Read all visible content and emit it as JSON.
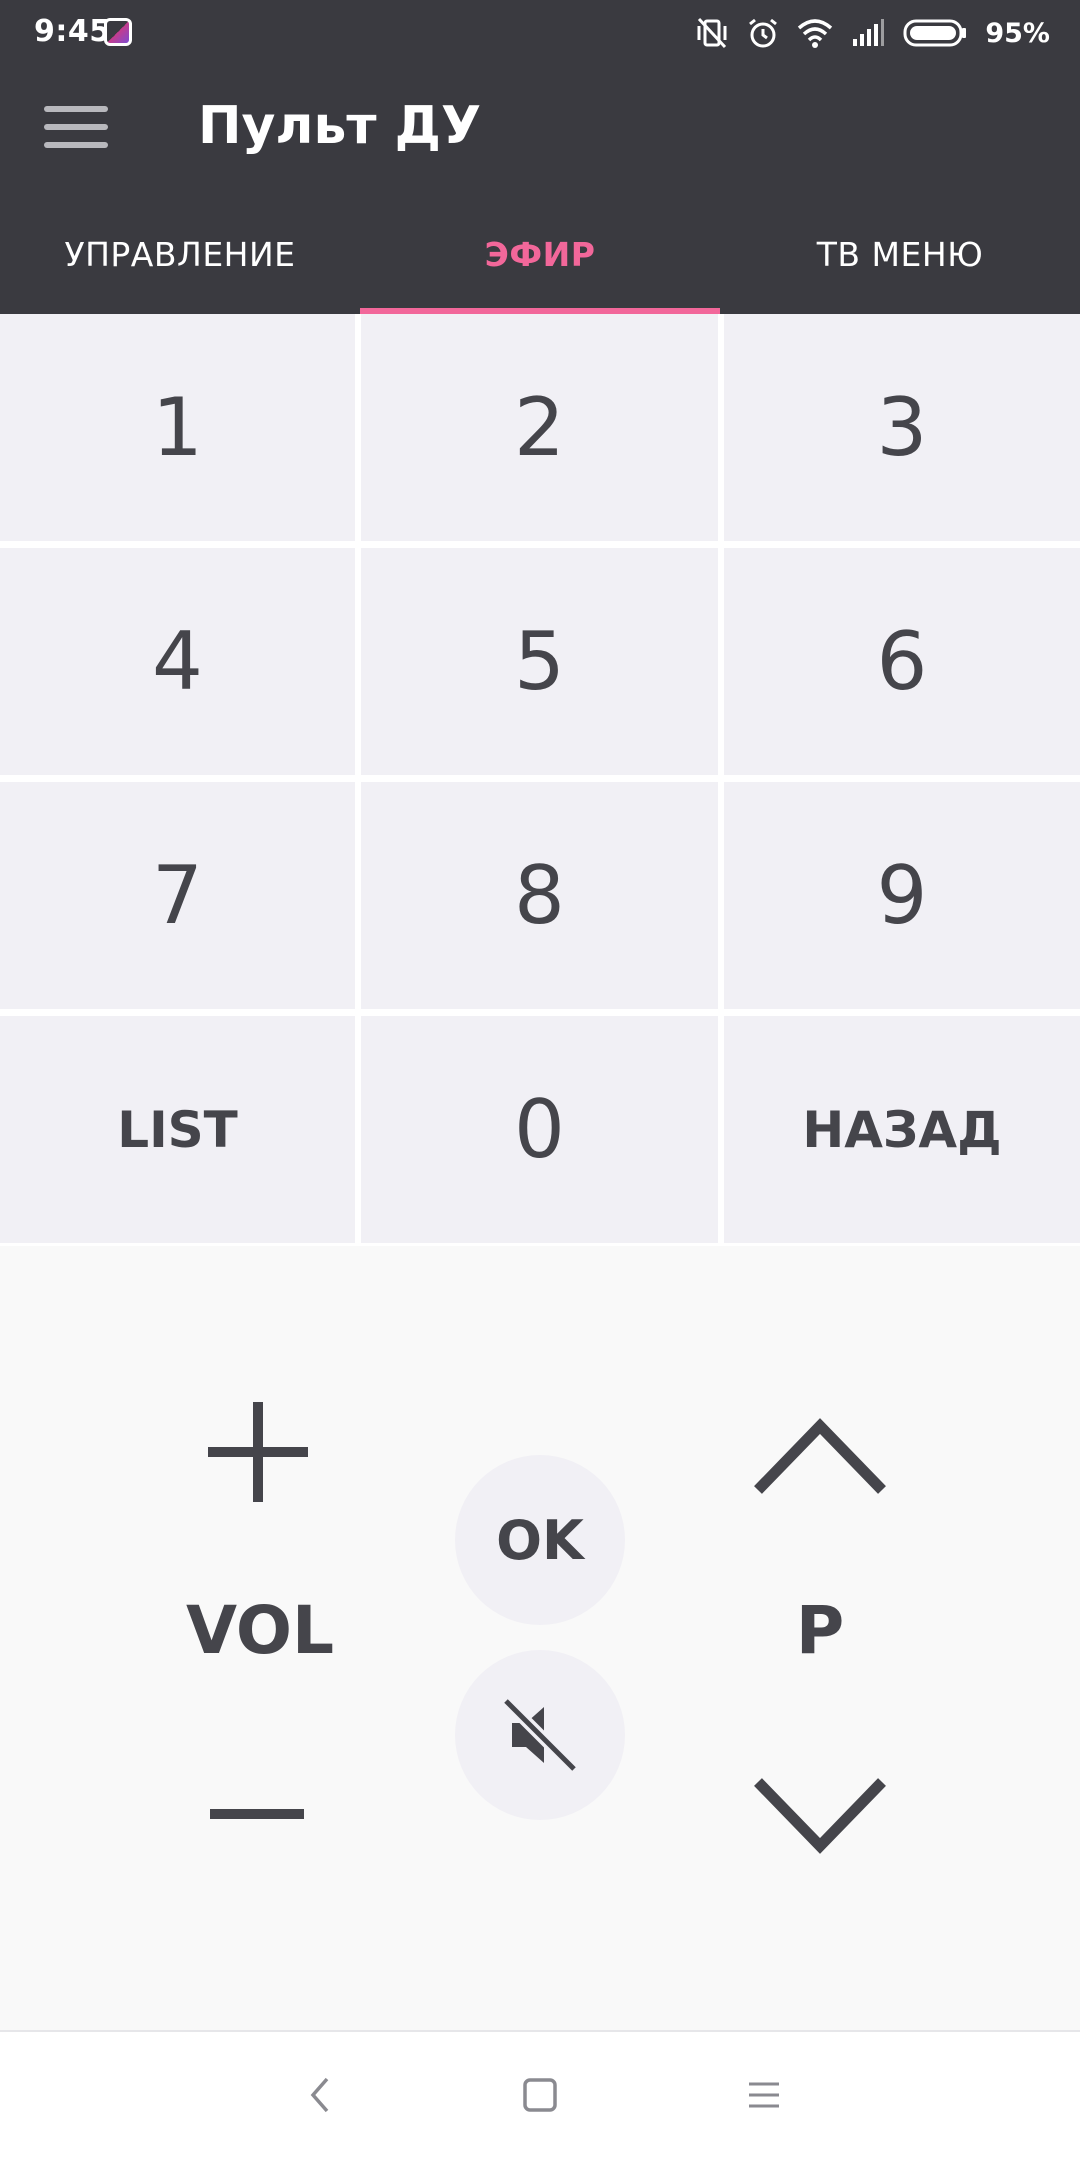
{
  "status_bar": {
    "time": "9:45",
    "battery_percent": "95%",
    "icons": [
      "app-notification-icon",
      "vibrate-off-icon",
      "alarm-icon",
      "wifi-icon",
      "signal-icon",
      "battery-icon"
    ]
  },
  "app_bar": {
    "title": "Пульт ДУ",
    "menu_icon": "hamburger-menu-icon"
  },
  "tabs": [
    {
      "label": "УПРАВЛЕНИЕ",
      "active": false
    },
    {
      "label": "ЭФИР",
      "active": true
    },
    {
      "label": "ТВ МЕНЮ",
      "active": false
    }
  ],
  "keypad": {
    "keys": [
      "1",
      "2",
      "3",
      "4",
      "5",
      "6",
      "7",
      "8",
      "9",
      "LIST",
      "0",
      "НАЗАД"
    ]
  },
  "controls": {
    "volume_label": "VOL",
    "volume_up_icon": "plus-icon",
    "volume_down_icon": "minus-icon",
    "ok_label": "OK",
    "mute_icon": "mute-icon",
    "channel_label": "P",
    "channel_up_icon": "chevron-up-icon",
    "channel_down_icon": "chevron-down-icon"
  },
  "nav_bar": {
    "icons": [
      "back-icon",
      "home-icon",
      "recent-apps-icon"
    ]
  },
  "colors": {
    "top_background": "#3a3a40",
    "accent": "#f2679a",
    "key_background": "#f1f0f5",
    "key_text": "#45454b",
    "page_background": "#f9f9f9"
  }
}
